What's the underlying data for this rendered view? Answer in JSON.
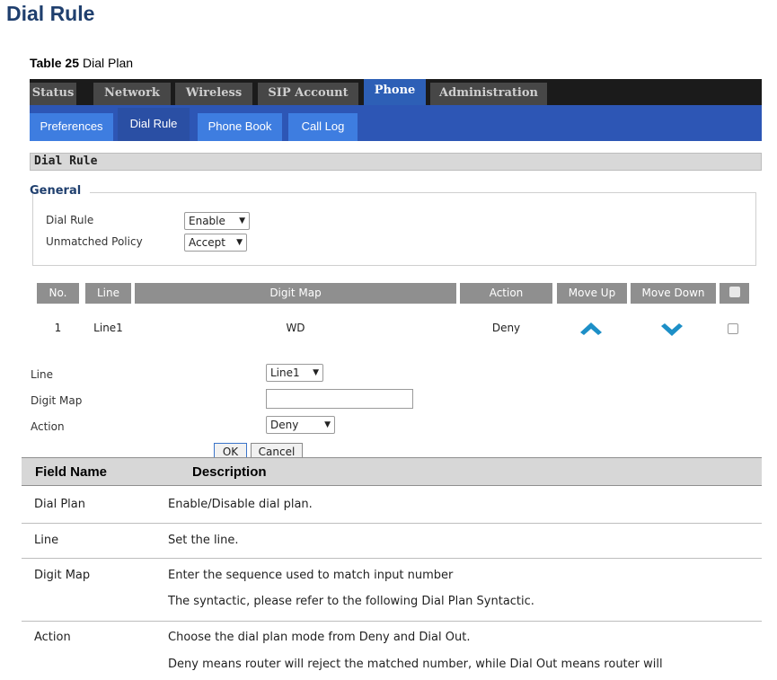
{
  "page_heading": "Dial Rule",
  "caption": {
    "number": "Table 25",
    "title": "Dial Plan"
  },
  "top_tabs": [
    {
      "label": "Status",
      "active": false
    },
    {
      "label": "Network",
      "active": false
    },
    {
      "label": "Wireless",
      "active": false
    },
    {
      "label": "SIP Account",
      "active": false
    },
    {
      "label": "Phone",
      "active": true
    },
    {
      "label": "Administration",
      "active": false
    }
  ],
  "sub_tabs": [
    {
      "label": "Preferences",
      "active": false
    },
    {
      "label": "Dial Rule",
      "active": true
    },
    {
      "label": "Phone Book",
      "active": false
    },
    {
      "label": "Call Log",
      "active": false
    }
  ],
  "section_title": "Dial Rule",
  "general": {
    "legend": "General",
    "dial_rule_label": "Dial Rule",
    "dial_rule_value": "Enable",
    "unmatched_policy_label": "Unmatched Policy",
    "unmatched_policy_value": "Accept"
  },
  "rule_table": {
    "headers": [
      "No.",
      "Line",
      "Digit Map",
      "Action",
      "Move Up",
      "Move Down"
    ],
    "rows": [
      {
        "no": "1",
        "line": "Line1",
        "digit_map": "WD",
        "action": "Deny",
        "checked": false
      }
    ]
  },
  "form": {
    "line_label": "Line",
    "line_value": "Line1",
    "digit_map_label": "Digit Map",
    "digit_map_value": "",
    "action_label": "Action",
    "action_value": "Deny",
    "ok_label": "OK",
    "cancel_label": "Cancel"
  },
  "description_table": {
    "headers": [
      "Field Name",
      "Description"
    ],
    "rows": [
      {
        "field": "Dial Plan",
        "lines": [
          "Enable/Disable dial plan."
        ]
      },
      {
        "field": "Line",
        "lines": [
          "Set the line."
        ]
      },
      {
        "field": "Digit Map",
        "lines": [
          "Enter the sequence used to match input number",
          "The syntactic, please refer to the following Dial Plan  Syntactic."
        ]
      },
      {
        "field": "Action",
        "lines": [
          "Choose the dial plan mode from Deny and Dial  Out.",
          "Deny means router will reject the matched number, while Dial Out means router will"
        ]
      }
    ]
  },
  "colors": {
    "heading": "#1f3f6e",
    "top_bar": "#1b1b1b",
    "top_tab": "#474747",
    "active_top_tab": "#2d5fb6",
    "sub_bar": "#2d56b5",
    "sub_tab": "#3e7de0",
    "table_header": "#8f8f8f",
    "arrow": "#1d8fc7"
  },
  "icons": {
    "move_up": "chevron-up-icon",
    "move_down": "chevron-down-icon",
    "select_arrow": "triangle-down-icon"
  }
}
